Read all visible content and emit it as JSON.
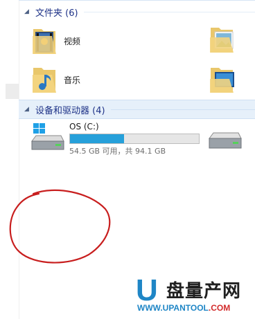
{
  "groups": {
    "folders": {
      "title": "文件夹 (6)"
    },
    "drives": {
      "title": "设备和驱动器 (4)"
    }
  },
  "folders": [
    {
      "name": "视频",
      "icon": "video-folder-icon"
    },
    {
      "name": "音乐",
      "icon": "music-folder-icon"
    },
    {
      "name": "",
      "icon": "pictures-folder-icon"
    },
    {
      "name": "",
      "icon": "desktop-folder-icon"
    }
  ],
  "drives": [
    {
      "name": "OS (C:)",
      "free_text": "54.5 GB 可用，共 94.1 GB",
      "used_fraction": 0.42,
      "icon": "windows-drive-icon"
    },
    {
      "name": "",
      "icon": "hard-drive-icon"
    }
  ],
  "watermark": {
    "letter": "U",
    "brand": "盘量产网",
    "url_prefix": "WWW.UPANTOOL",
    "url_suffix": ".COM"
  },
  "colors": {
    "accent": "#26a0da",
    "header_text": "#1e3287",
    "scribble": "#c81e1e",
    "brand_blue": "#1f86c6"
  }
}
